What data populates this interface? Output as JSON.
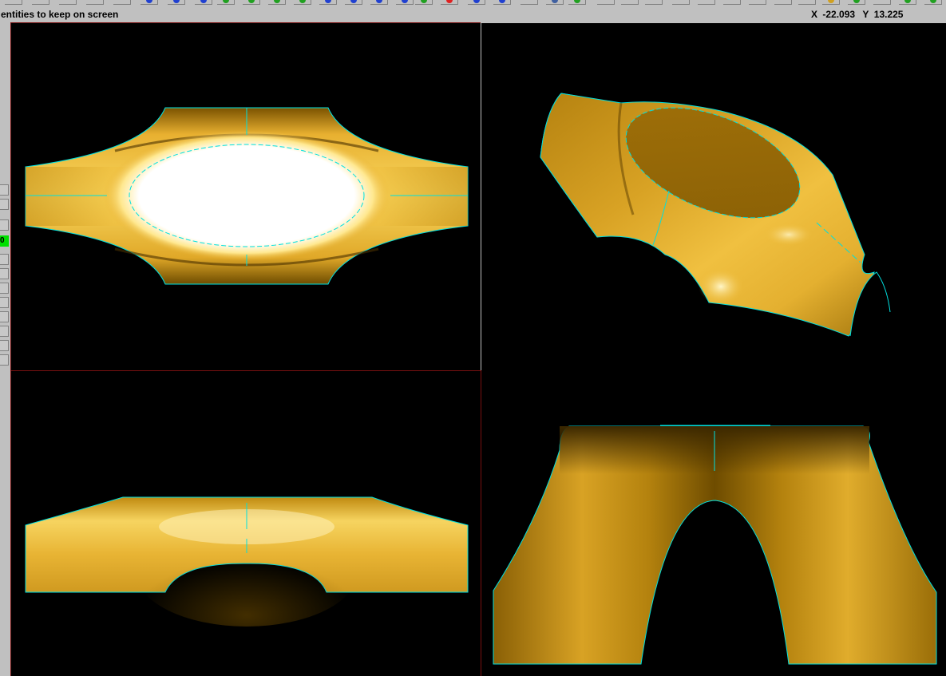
{
  "status": {
    "prompt": "entities to keep on screen",
    "coord_x_label": "X",
    "coord_x_value": "-22.093",
    "coord_y_label": "Y",
    "coord_y_value": "13.225"
  },
  "side_panel": {
    "active_field_text": "0"
  },
  "toolbar_icons": [
    "select-icon",
    "zoom-icon",
    "zoom-icon",
    "pan-icon",
    "view-icon",
    "view-icon",
    "rotate-icon",
    "rotate-icon",
    "rotate-icon",
    "rotate-icon",
    "cube-icon",
    "cube-icon",
    "cube-icon",
    "cube-icon",
    "cube-icon",
    "stop-icon",
    "arrow-icon",
    "arrow-icon",
    "shade-icon",
    "shade-icon",
    "render-icon",
    "color-icon"
  ],
  "viewports": [
    {
      "id": "top",
      "name": "top-view"
    },
    {
      "id": "iso",
      "name": "isometric-view"
    },
    {
      "id": "front",
      "name": "front-view"
    },
    {
      "id": "side",
      "name": "side-view"
    }
  ],
  "colors": {
    "surface_dark": "#6e4c00",
    "surface_mid": "#c8920e",
    "surface_light": "#f2c84a",
    "highlight": "#ffffff",
    "edge": "#00e0e0",
    "viewport_bg": "#000000",
    "viewport_border": "#7a1010",
    "active_field": "#00e000"
  }
}
